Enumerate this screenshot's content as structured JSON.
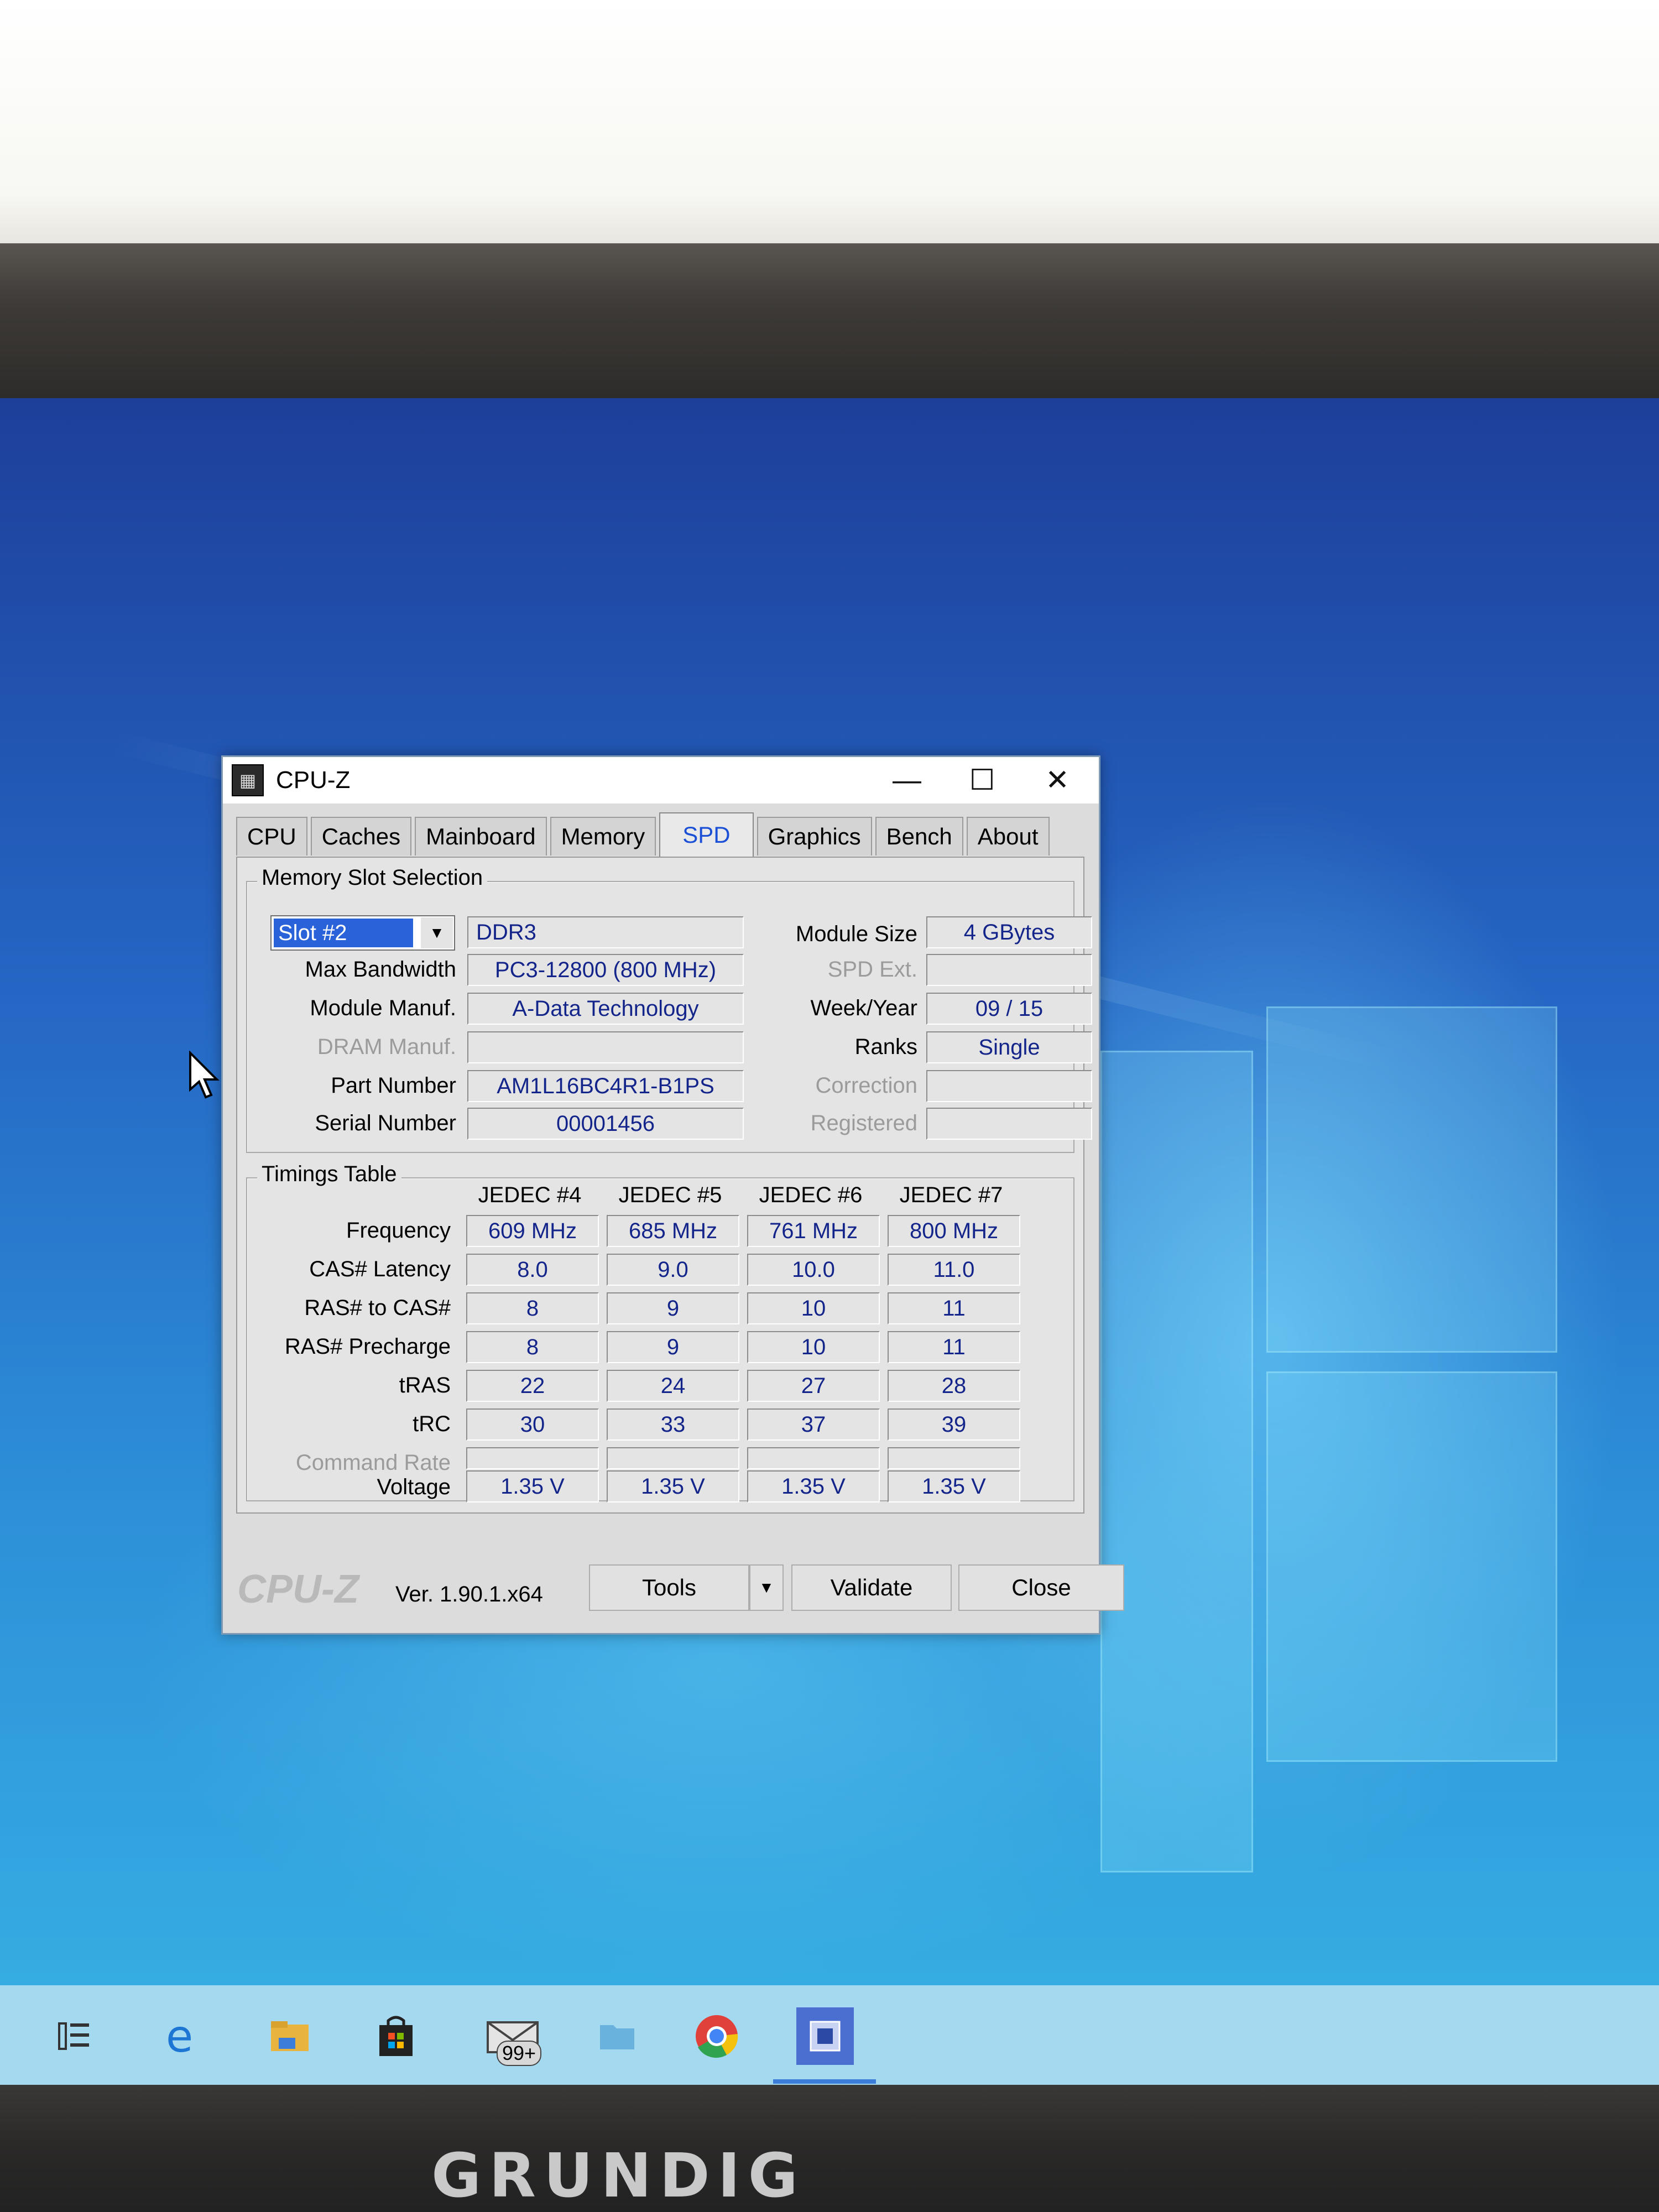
{
  "window": {
    "title": "CPU-Z",
    "minimize_glyph": "—",
    "maximize_glyph": "☐",
    "close_glyph": "✕"
  },
  "tabs": [
    {
      "label": "CPU"
    },
    {
      "label": "Caches"
    },
    {
      "label": "Mainboard"
    },
    {
      "label": "Memory"
    },
    {
      "label": "SPD",
      "active": true
    },
    {
      "label": "Graphics"
    },
    {
      "label": "Bench"
    },
    {
      "label": "About"
    }
  ],
  "slot_group": {
    "title": "Memory Slot Selection",
    "slot_selected": "Slot #2",
    "memory_type": "DDR3",
    "labels": {
      "max_bandwidth": "Max Bandwidth",
      "module_manuf": "Module Manuf.",
      "dram_manuf": "DRAM Manuf.",
      "part_number": "Part Number",
      "serial_number": "Serial Number",
      "module_size": "Module Size",
      "spd_ext": "SPD Ext.",
      "week_year": "Week/Year",
      "ranks": "Ranks",
      "correction": "Correction",
      "registered": "Registered"
    },
    "values": {
      "max_bandwidth": "PC3-12800 (800 MHz)",
      "module_manuf": "A-Data Technology",
      "dram_manuf": "",
      "part_number": "AM1L16BC4R1-B1PS",
      "serial_number": "00001456",
      "module_size": "4 GBytes",
      "spd_ext": "",
      "week_year": "09 / 15",
      "ranks": "Single",
      "correction": "",
      "registered": ""
    }
  },
  "timings": {
    "title": "Timings Table",
    "columns": [
      "JEDEC #4",
      "JEDEC #5",
      "JEDEC #6",
      "JEDEC #7"
    ],
    "rows": [
      {
        "label": "Frequency",
        "values": [
          "609 MHz",
          "685 MHz",
          "761 MHz",
          "800 MHz"
        ]
      },
      {
        "label": "CAS# Latency",
        "values": [
          "8.0",
          "9.0",
          "10.0",
          "11.0"
        ]
      },
      {
        "label": "RAS# to CAS#",
        "values": [
          "8",
          "9",
          "10",
          "11"
        ]
      },
      {
        "label": "RAS# Precharge",
        "values": [
          "8",
          "9",
          "10",
          "11"
        ]
      },
      {
        "label": "tRAS",
        "values": [
          "22",
          "24",
          "27",
          "28"
        ]
      },
      {
        "label": "tRC",
        "values": [
          "30",
          "33",
          "37",
          "39"
        ]
      },
      {
        "label": "Command Rate",
        "values": [
          "",
          "",
          "",
          ""
        ],
        "dim": true
      },
      {
        "label": "Voltage",
        "values": [
          "1.35 V",
          "1.35 V",
          "1.35 V",
          "1.35 V"
        ]
      }
    ]
  },
  "footer": {
    "brand": "CPU-Z",
    "version": "Ver. 1.90.1.x64",
    "tools_label": "Tools",
    "validate_label": "Validate",
    "close_label": "Close"
  },
  "taskbar": {
    "mail_badge": "99+",
    "items": [
      "task-view-icon",
      "edge-icon",
      "file-explorer-icon",
      "store-icon",
      "mail-icon",
      "folder-icon",
      "chrome-icon",
      "cpuz-icon"
    ]
  },
  "laptop": {
    "brand_logo": "GRUNDIG"
  },
  "colors": {
    "accent_tab": "#1a4fd6",
    "value_text": "#13258a",
    "selection": "#2a63d9"
  }
}
